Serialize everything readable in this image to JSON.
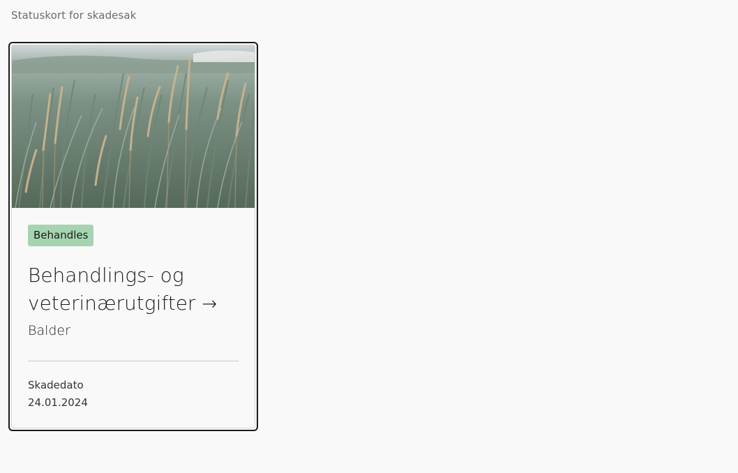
{
  "page": {
    "heading": "Statuskort for skadesak"
  },
  "card": {
    "image_alt": "grass-photo",
    "status_badge": "Behandles",
    "title": "Behandlings- og veterinærutgifter",
    "title_arrow": "→",
    "subtitle": "Balder",
    "meta": {
      "label": "Skadedato",
      "value": "24.01.2024"
    }
  },
  "colors": {
    "background": "#f9f9f9",
    "badge_bg": "#a6d4b1",
    "focus_ring": "#1a1a1a",
    "text": "#1a1a1a",
    "muted_text": "#6b6b6b"
  }
}
